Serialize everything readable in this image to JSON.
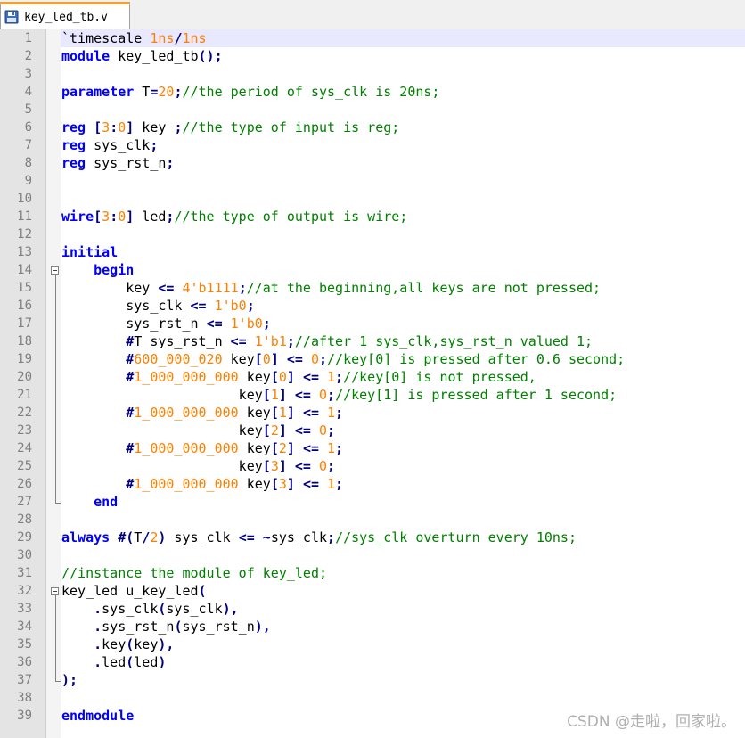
{
  "tab": {
    "title": "key_led_tb.v",
    "icon": "save-file-icon"
  },
  "editor": {
    "current_line": 1,
    "lines": [
      [
        {
          "t": "`timescale ",
          "c": "td"
        },
        {
          "t": "1ns",
          "c": "num"
        },
        {
          "t": "/",
          "c": "op"
        },
        {
          "t": "1ns",
          "c": "num"
        }
      ],
      [
        {
          "t": "module",
          "c": "kw"
        },
        {
          "t": " key_led_tb",
          "c": "td"
        },
        {
          "t": "();",
          "c": "op"
        }
      ],
      [],
      [
        {
          "t": "parameter",
          "c": "kw"
        },
        {
          "t": " T",
          "c": "td"
        },
        {
          "t": "=",
          "c": "op"
        },
        {
          "t": "20",
          "c": "num"
        },
        {
          "t": ";",
          "c": "op"
        },
        {
          "t": "//the period of sys_clk is 20ns;",
          "c": "cm"
        }
      ],
      [],
      [
        {
          "t": "reg",
          "c": "kw"
        },
        {
          "t": " ",
          "c": "td"
        },
        {
          "t": "[",
          "c": "op"
        },
        {
          "t": "3",
          "c": "num"
        },
        {
          "t": ":",
          "c": "op"
        },
        {
          "t": "0",
          "c": "num"
        },
        {
          "t": "]",
          "c": "op"
        },
        {
          "t": " key ",
          "c": "td"
        },
        {
          "t": ";",
          "c": "op"
        },
        {
          "t": "//the type of input is reg;",
          "c": "cm"
        }
      ],
      [
        {
          "t": "reg",
          "c": "kw"
        },
        {
          "t": " sys_clk",
          "c": "td"
        },
        {
          "t": ";",
          "c": "op"
        }
      ],
      [
        {
          "t": "reg",
          "c": "kw"
        },
        {
          "t": " sys_rst_n",
          "c": "td"
        },
        {
          "t": ";",
          "c": "op"
        }
      ],
      [],
      [],
      [
        {
          "t": "wire",
          "c": "kw"
        },
        {
          "t": "[",
          "c": "op"
        },
        {
          "t": "3",
          "c": "num"
        },
        {
          "t": ":",
          "c": "op"
        },
        {
          "t": "0",
          "c": "num"
        },
        {
          "t": "]",
          "c": "op"
        },
        {
          "t": " led",
          "c": "td"
        },
        {
          "t": ";",
          "c": "op"
        },
        {
          "t": "//the type of output is wire;",
          "c": "cm"
        }
      ],
      [],
      [
        {
          "t": "initial",
          "c": "kw"
        }
      ],
      [
        {
          "t": "    ",
          "c": "td"
        },
        {
          "t": "begin",
          "c": "kw"
        }
      ],
      [
        {
          "t": "        key ",
          "c": "td"
        },
        {
          "t": "<=",
          "c": "op"
        },
        {
          "t": " ",
          "c": "td"
        },
        {
          "t": "4'b1111",
          "c": "num"
        },
        {
          "t": ";",
          "c": "op"
        },
        {
          "t": "//at the beginning,all keys are not pressed;",
          "c": "cm"
        }
      ],
      [
        {
          "t": "        sys_clk ",
          "c": "td"
        },
        {
          "t": "<=",
          "c": "op"
        },
        {
          "t": " ",
          "c": "td"
        },
        {
          "t": "1'b0",
          "c": "num"
        },
        {
          "t": ";",
          "c": "op"
        }
      ],
      [
        {
          "t": "        sys_rst_n ",
          "c": "td"
        },
        {
          "t": "<=",
          "c": "op"
        },
        {
          "t": " ",
          "c": "td"
        },
        {
          "t": "1'b0",
          "c": "num"
        },
        {
          "t": ";",
          "c": "op"
        }
      ],
      [
        {
          "t": "        ",
          "c": "td"
        },
        {
          "t": "#",
          "c": "op"
        },
        {
          "t": "T sys_rst_n ",
          "c": "td"
        },
        {
          "t": "<=",
          "c": "op"
        },
        {
          "t": " ",
          "c": "td"
        },
        {
          "t": "1'b1",
          "c": "num"
        },
        {
          "t": ";",
          "c": "op"
        },
        {
          "t": "//after 1 sys_clk,sys_rst_n valued 1;",
          "c": "cm"
        }
      ],
      [
        {
          "t": "        ",
          "c": "td"
        },
        {
          "t": "#",
          "c": "op"
        },
        {
          "t": "600_000_020",
          "c": "num"
        },
        {
          "t": " key",
          "c": "td"
        },
        {
          "t": "[",
          "c": "op"
        },
        {
          "t": "0",
          "c": "num"
        },
        {
          "t": "]",
          "c": "op"
        },
        {
          "t": " ",
          "c": "td"
        },
        {
          "t": "<=",
          "c": "op"
        },
        {
          "t": " ",
          "c": "td"
        },
        {
          "t": "0",
          "c": "num"
        },
        {
          "t": ";",
          "c": "op"
        },
        {
          "t": "//key[0] is pressed after 0.6 second;",
          "c": "cm"
        }
      ],
      [
        {
          "t": "        ",
          "c": "td"
        },
        {
          "t": "#",
          "c": "op"
        },
        {
          "t": "1_000_000_000",
          "c": "num"
        },
        {
          "t": " key",
          "c": "td"
        },
        {
          "t": "[",
          "c": "op"
        },
        {
          "t": "0",
          "c": "num"
        },
        {
          "t": "]",
          "c": "op"
        },
        {
          "t": " ",
          "c": "td"
        },
        {
          "t": "<=",
          "c": "op"
        },
        {
          "t": " ",
          "c": "td"
        },
        {
          "t": "1",
          "c": "num"
        },
        {
          "t": ";",
          "c": "op"
        },
        {
          "t": "//key[0] is not pressed,",
          "c": "cm"
        }
      ],
      [
        {
          "t": "                      key",
          "c": "td"
        },
        {
          "t": "[",
          "c": "op"
        },
        {
          "t": "1",
          "c": "num"
        },
        {
          "t": "]",
          "c": "op"
        },
        {
          "t": " ",
          "c": "td"
        },
        {
          "t": "<=",
          "c": "op"
        },
        {
          "t": " ",
          "c": "td"
        },
        {
          "t": "0",
          "c": "num"
        },
        {
          "t": ";",
          "c": "op"
        },
        {
          "t": "//key[1] is pressed after 1 second;",
          "c": "cm"
        }
      ],
      [
        {
          "t": "        ",
          "c": "td"
        },
        {
          "t": "#",
          "c": "op"
        },
        {
          "t": "1_000_000_000",
          "c": "num"
        },
        {
          "t": " key",
          "c": "td"
        },
        {
          "t": "[",
          "c": "op"
        },
        {
          "t": "1",
          "c": "num"
        },
        {
          "t": "]",
          "c": "op"
        },
        {
          "t": " ",
          "c": "td"
        },
        {
          "t": "<=",
          "c": "op"
        },
        {
          "t": " ",
          "c": "td"
        },
        {
          "t": "1",
          "c": "num"
        },
        {
          "t": ";",
          "c": "op"
        }
      ],
      [
        {
          "t": "                      key",
          "c": "td"
        },
        {
          "t": "[",
          "c": "op"
        },
        {
          "t": "2",
          "c": "num"
        },
        {
          "t": "]",
          "c": "op"
        },
        {
          "t": " ",
          "c": "td"
        },
        {
          "t": "<=",
          "c": "op"
        },
        {
          "t": " ",
          "c": "td"
        },
        {
          "t": "0",
          "c": "num"
        },
        {
          "t": ";",
          "c": "op"
        }
      ],
      [
        {
          "t": "        ",
          "c": "td"
        },
        {
          "t": "#",
          "c": "op"
        },
        {
          "t": "1_000_000_000",
          "c": "num"
        },
        {
          "t": " key",
          "c": "td"
        },
        {
          "t": "[",
          "c": "op"
        },
        {
          "t": "2",
          "c": "num"
        },
        {
          "t": "]",
          "c": "op"
        },
        {
          "t": " ",
          "c": "td"
        },
        {
          "t": "<=",
          "c": "op"
        },
        {
          "t": " ",
          "c": "td"
        },
        {
          "t": "1",
          "c": "num"
        },
        {
          "t": ";",
          "c": "op"
        }
      ],
      [
        {
          "t": "                      key",
          "c": "td"
        },
        {
          "t": "[",
          "c": "op"
        },
        {
          "t": "3",
          "c": "num"
        },
        {
          "t": "]",
          "c": "op"
        },
        {
          "t": " ",
          "c": "td"
        },
        {
          "t": "<=",
          "c": "op"
        },
        {
          "t": " ",
          "c": "td"
        },
        {
          "t": "0",
          "c": "num"
        },
        {
          "t": ";",
          "c": "op"
        }
      ],
      [
        {
          "t": "        ",
          "c": "td"
        },
        {
          "t": "#",
          "c": "op"
        },
        {
          "t": "1_000_000_000",
          "c": "num"
        },
        {
          "t": " key",
          "c": "td"
        },
        {
          "t": "[",
          "c": "op"
        },
        {
          "t": "3",
          "c": "num"
        },
        {
          "t": "]",
          "c": "op"
        },
        {
          "t": " ",
          "c": "td"
        },
        {
          "t": "<=",
          "c": "op"
        },
        {
          "t": " ",
          "c": "td"
        },
        {
          "t": "1",
          "c": "num"
        },
        {
          "t": ";",
          "c": "op"
        }
      ],
      [
        {
          "t": "    ",
          "c": "td"
        },
        {
          "t": "end",
          "c": "kw"
        }
      ],
      [],
      [
        {
          "t": "always",
          "c": "kw"
        },
        {
          "t": " ",
          "c": "td"
        },
        {
          "t": "#(",
          "c": "op"
        },
        {
          "t": "T",
          "c": "td"
        },
        {
          "t": "/",
          "c": "op"
        },
        {
          "t": "2",
          "c": "num"
        },
        {
          "t": ")",
          "c": "op"
        },
        {
          "t": " sys_clk ",
          "c": "td"
        },
        {
          "t": "<=",
          "c": "op"
        },
        {
          "t": " ",
          "c": "td"
        },
        {
          "t": "~",
          "c": "op"
        },
        {
          "t": "sys_clk",
          "c": "td"
        },
        {
          "t": ";",
          "c": "op"
        },
        {
          "t": "//sys_clk overturn every 10ns;",
          "c": "cm"
        }
      ],
      [],
      [
        {
          "t": "//instance the module of key_led;",
          "c": "cm"
        }
      ],
      [
        {
          "t": "key_led u_key_led",
          "c": "td"
        },
        {
          "t": "(",
          "c": "op"
        }
      ],
      [
        {
          "t": "    ",
          "c": "td"
        },
        {
          "t": ".",
          "c": "op"
        },
        {
          "t": "sys_clk",
          "c": "td"
        },
        {
          "t": "(",
          "c": "op"
        },
        {
          "t": "sys_clk",
          "c": "td"
        },
        {
          "t": "),",
          "c": "op"
        }
      ],
      [
        {
          "t": "    ",
          "c": "td"
        },
        {
          "t": ".",
          "c": "op"
        },
        {
          "t": "sys_rst_n",
          "c": "td"
        },
        {
          "t": "(",
          "c": "op"
        },
        {
          "t": "sys_rst_n",
          "c": "td"
        },
        {
          "t": "),",
          "c": "op"
        }
      ],
      [
        {
          "t": "    ",
          "c": "td"
        },
        {
          "t": ".",
          "c": "op"
        },
        {
          "t": "key",
          "c": "td"
        },
        {
          "t": "(",
          "c": "op"
        },
        {
          "t": "key",
          "c": "td"
        },
        {
          "t": "),",
          "c": "op"
        }
      ],
      [
        {
          "t": "    ",
          "c": "td"
        },
        {
          "t": ".",
          "c": "op"
        },
        {
          "t": "led",
          "c": "td"
        },
        {
          "t": "(",
          "c": "op"
        },
        {
          "t": "led",
          "c": "td"
        },
        {
          "t": ")",
          "c": "op"
        }
      ],
      [
        {
          "t": ");",
          "c": "op"
        }
      ],
      [],
      [
        {
          "t": "endmodule",
          "c": "kw"
        }
      ]
    ]
  },
  "colors": {
    "keyword": "#0000ff",
    "number": "#ff8000",
    "comment": "#008000",
    "operator": "#000080",
    "line_number": "#808080",
    "current_line_bg": "#e8e8ff"
  },
  "watermark": "CSDN @走啦，回家啦。"
}
